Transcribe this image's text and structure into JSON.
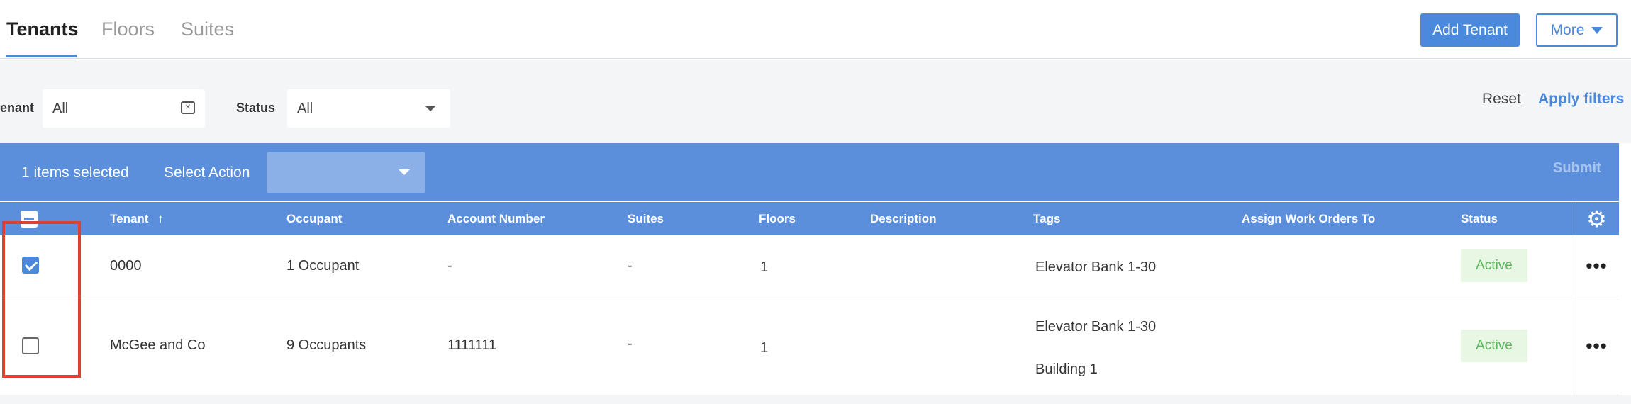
{
  "tabs": [
    {
      "label": "Tenants",
      "active": true
    },
    {
      "label": "Floors",
      "active": false
    },
    {
      "label": "Suites",
      "active": false
    }
  ],
  "header_actions": {
    "add_tenant": "Add Tenant",
    "more": "More"
  },
  "filters": {
    "tenant_label": "enant",
    "tenant_value": "All",
    "status_label": "Status",
    "status_value": "All",
    "reset": "Reset",
    "apply": "Apply filters"
  },
  "action_bar": {
    "selected_count": "1 items selected",
    "select_action_label": "Select Action",
    "action_value": "",
    "submit": "Submit"
  },
  "table": {
    "columns": [
      "Tenant",
      "Occupant",
      "Account Number",
      "Suites",
      "Floors",
      "Description",
      "Tags",
      "Assign Work Orders To",
      "Status"
    ],
    "sort_indicator": "↑",
    "rows": [
      {
        "checked": true,
        "tenant": "0000",
        "occupant": "1 Occupant",
        "account_number": "-",
        "suites": "-",
        "floors": "1",
        "description": "",
        "tags": [
          "Elevator Bank 1-30"
        ],
        "assign_to": "",
        "status": "Active"
      },
      {
        "checked": false,
        "tenant": "McGee and Co",
        "occupant": "9 Occupants",
        "account_number": "1111111",
        "suites": "-",
        "floors": "1",
        "description": "",
        "tags": [
          "Elevator Bank 1-30",
          "Building 1"
        ],
        "assign_to": "",
        "status": "Active"
      }
    ]
  },
  "icons": {
    "settings": "gear-icon",
    "row_menu": "more-horizontal-icon",
    "more_caret": "caret-down-icon"
  },
  "colors": {
    "accent": "#4a89dc",
    "header_bar": "#5b8fdb",
    "status_active_text": "#5cb85c",
    "status_active_bg": "#e8f7e4",
    "highlight": "#e0412f"
  }
}
